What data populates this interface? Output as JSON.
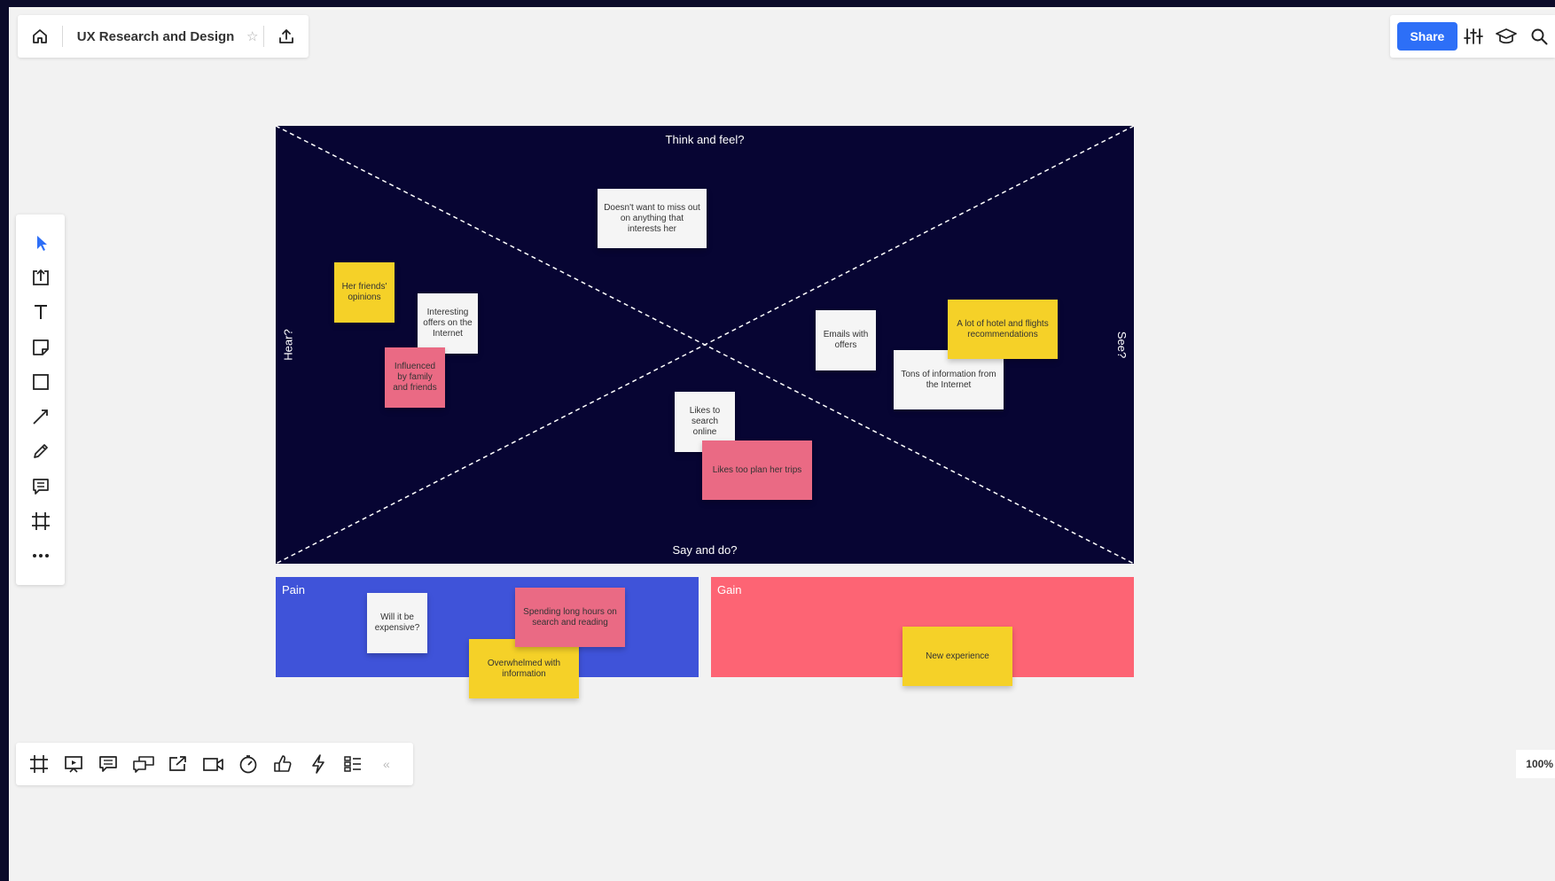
{
  "header": {
    "board_title": "UX Research and Design",
    "share_label": "Share"
  },
  "left_toolbar": {
    "tools": [
      "select-tool",
      "upload-tool",
      "text-tool",
      "sticky-note-tool",
      "shape-tool",
      "connection-line-tool",
      "pen-tool",
      "comment-tool",
      "frame-tool",
      "more-tools"
    ]
  },
  "empathy_map": {
    "top_label": "Think and feel?",
    "bottom_label": "Say and do?",
    "left_label": "Hear?",
    "right_label": "See?",
    "notes": {
      "miss_out": "Doesn't want to miss out on anything that interests her",
      "friends_opinions": "Her friends' opinions",
      "interesting_offers": "Interesting offers on the Internet",
      "influenced": "Influenced by family and friends",
      "emails": "Emails with offers",
      "hotel_flights": "A lot of hotel and flights recommendations",
      "tons_info": "Tons of information from the Internet",
      "search_online": "Likes to search online",
      "plan_trips": "Likes too plan her trips"
    }
  },
  "pain": {
    "label": "Pain",
    "notes": {
      "expensive": "Will it be expensive?",
      "spending_hours": "Spending long hours on search and reading",
      "overwhelmed": "Overwhelmed with information"
    }
  },
  "gain": {
    "label": "Gain",
    "notes": {
      "new_experience": "New experience"
    }
  },
  "zoom": "100%",
  "colors": {
    "canvas": "#f2f2f2",
    "empathy_bg": "#070533",
    "pain_bg": "#3f53d9",
    "gain_bg": "#fd6474",
    "sticky_yellow": "#f5d128",
    "sticky_pink": "#ea6a84",
    "sticky_white": "#f5f5f5",
    "accent": "#2d6ff7"
  }
}
